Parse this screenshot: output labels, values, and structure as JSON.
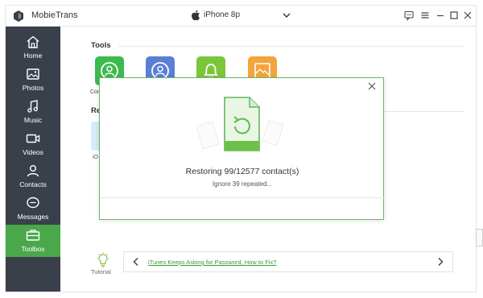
{
  "app": {
    "title": "MobieTrans"
  },
  "device": {
    "name": "iPhone 8p"
  },
  "sidebar": {
    "items": [
      {
        "label": "Home"
      },
      {
        "label": "Photos"
      },
      {
        "label": "Music"
      },
      {
        "label": "Videos"
      },
      {
        "label": "Contacts"
      },
      {
        "label": "Messages"
      },
      {
        "label": "Toolbox"
      }
    ],
    "active": "Toolbox"
  },
  "main": {
    "tools_heading": "Tools",
    "tools": [
      {
        "label": "Conta",
        "color": "#3cba4e",
        "icon": "contact-restore-icon"
      },
      {
        "label": "",
        "color": "#5b7ed6",
        "icon": "contact-backup-icon"
      },
      {
        "label": "",
        "color": "#7cc63b",
        "icon": "ringtone-bell-icon"
      },
      {
        "label": "",
        "color": "#f4a43c",
        "icon": "heic-converter-icon"
      }
    ],
    "second_heading": "Re",
    "ios_label": "iO"
  },
  "dialog": {
    "status": "Restoring 99/12577 contact(s)",
    "sub": "Ignore 39 repeated..."
  },
  "tutorial": {
    "label": "Tutorial",
    "tip_link": "iTunes Keeps Asking for Password, How to Fix?"
  },
  "colors": {
    "sidebar": "#3a404a",
    "accent": "#4aa84a",
    "dialog_border": "#6ab86a"
  }
}
